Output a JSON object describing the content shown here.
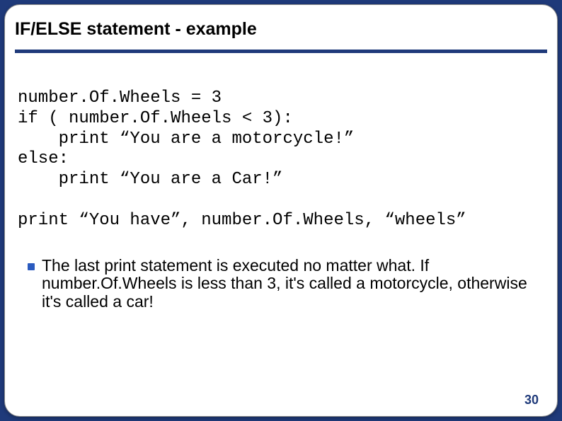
{
  "slide": {
    "title": "IF/ELSE statement - example",
    "code": "number.Of.Wheels = 3\nif ( number.Of.Wheels < 3):\n    print “You are a motorcycle!”\nelse:\n    print “You are a Car!”\n\nprint “You have”, number.Of.Wheels, “wheels”",
    "body": "The last print statement is executed no matter what. If number.Of.Wheels is less than 3, it's called a motorcycle, otherwise it's called a car!",
    "page_number": "30"
  }
}
